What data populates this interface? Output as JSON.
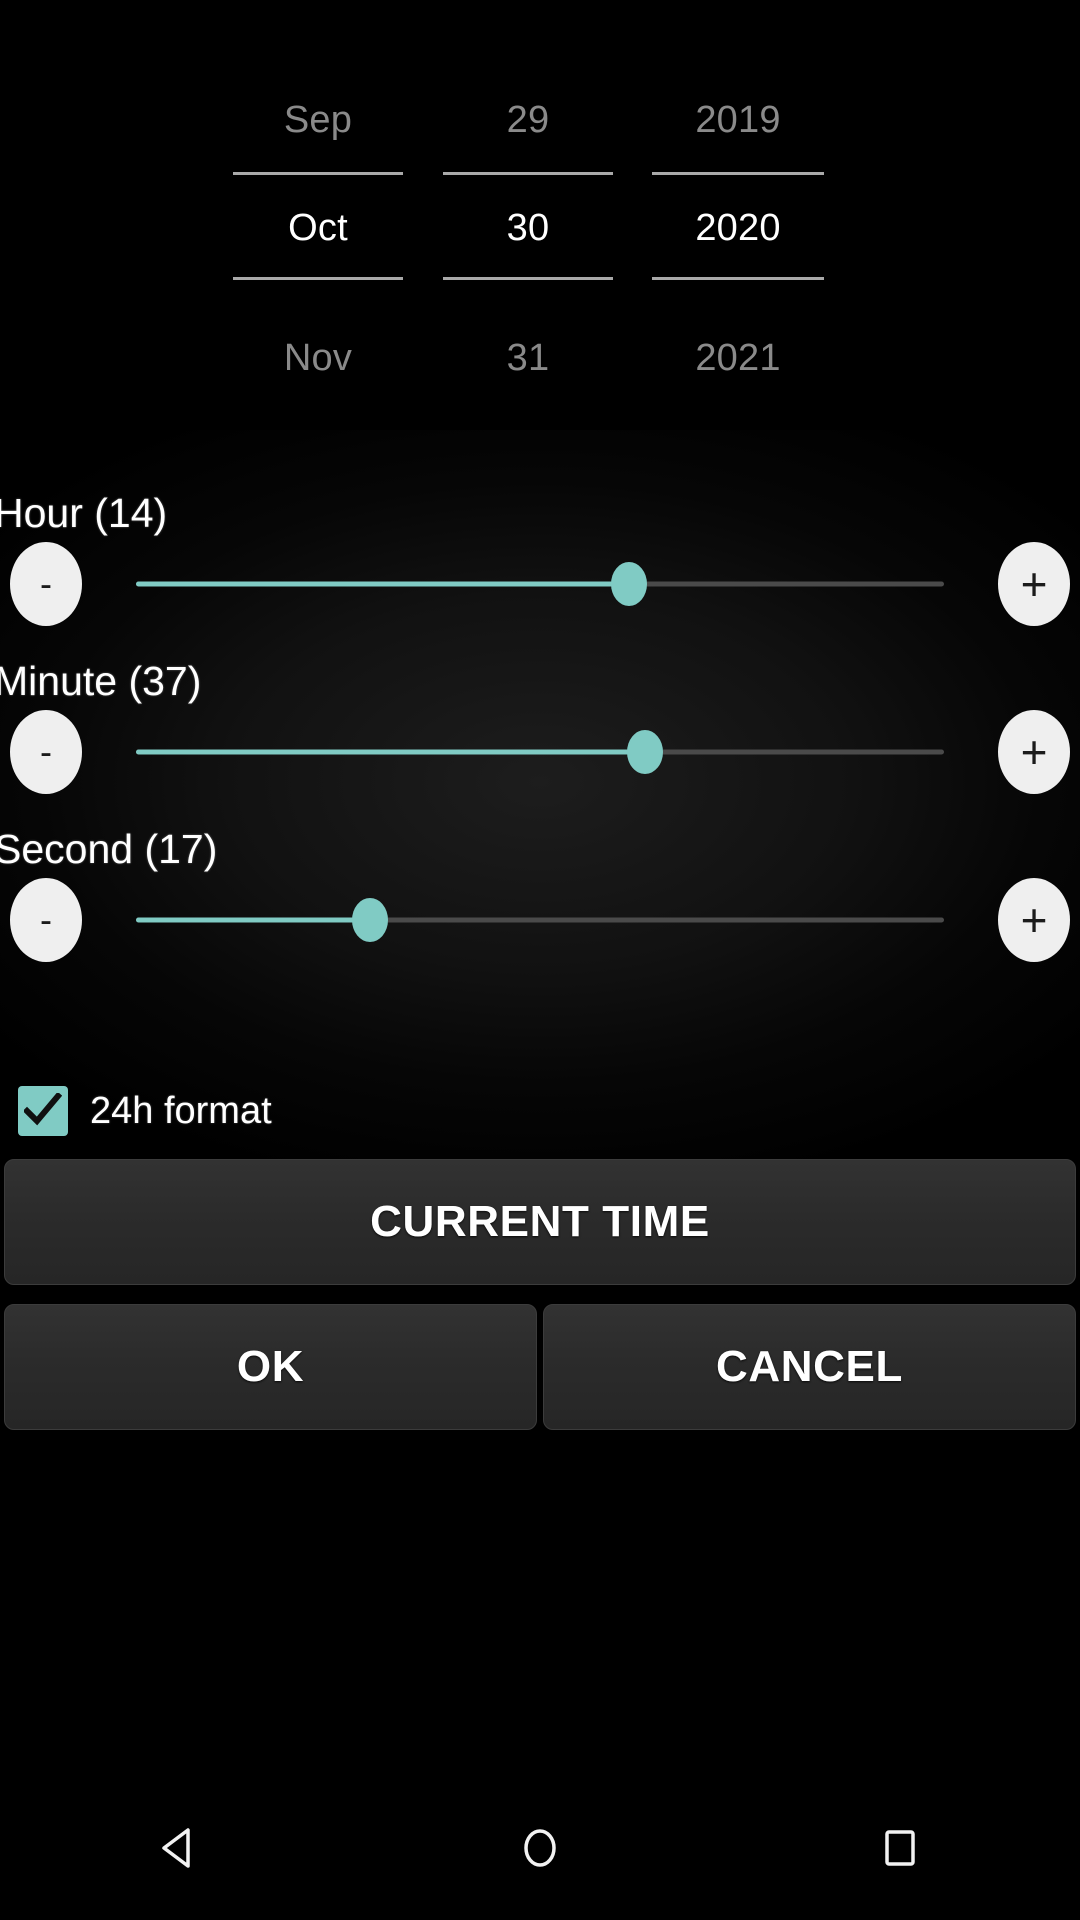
{
  "date_picker": {
    "month": {
      "previous": "Sep",
      "current": "Oct",
      "next": "Nov"
    },
    "day": {
      "previous": "29",
      "current": "30",
      "next": "31"
    },
    "year": {
      "previous": "2019",
      "current": "2020",
      "next": "2021"
    }
  },
  "sliders": [
    {
      "name": "hour",
      "label": "Hour (14)",
      "value": 14,
      "min": 0,
      "max": 23,
      "fill_percent": 61,
      "decrement_label": "-",
      "increment_label": "+"
    },
    {
      "name": "minute",
      "label": "Minute (37)",
      "value": 37,
      "min": 0,
      "max": 59,
      "fill_percent": 63,
      "decrement_label": "-",
      "increment_label": "+"
    },
    {
      "name": "second",
      "label": "Second (17)",
      "value": 17,
      "min": 0,
      "max": 59,
      "fill_percent": 29,
      "decrement_label": "-",
      "increment_label": "+"
    }
  ],
  "format_checkbox": {
    "label": "24h format",
    "checked": true
  },
  "buttons": {
    "current_time": "CURRENT TIME",
    "ok": "OK",
    "cancel": "CANCEL"
  },
  "navbar": {
    "back": "back",
    "home": "home",
    "recents": "recents"
  },
  "colors": {
    "accent": "#80cbc4",
    "background": "#000000",
    "button_face": "#2b2b2b",
    "step_button": "#efefef",
    "inactive_text": "#8a8a8a",
    "active_text": "#ffffff",
    "track_inactive": "#4a4a4a"
  }
}
